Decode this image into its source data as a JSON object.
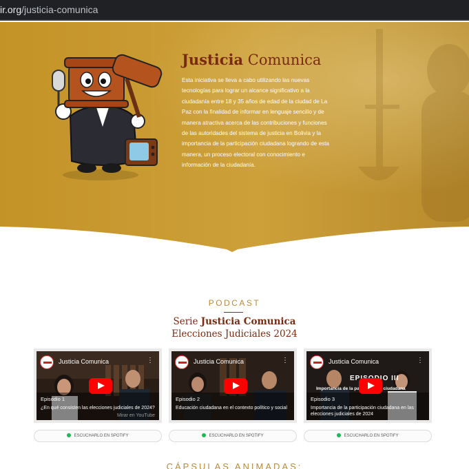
{
  "browser": {
    "url_domain": "ir.org",
    "url_path": "/justicia-comunica"
  },
  "hero": {
    "title_bold": "Justicia",
    "title_light": "Comunica",
    "description": "Esta iniciativa se lleva a cabo utilizando las nuevas tecnologías para lograr un alcance significativo a la ciudadanía entre 18 y 35 años de edad de la ciudad de La Paz con la finalidad de informar en lenguaje sencillo y de manera atractiva acerca de las contribuciones y funciones de las autoridades del sistema de justicia en Bolivia y la importancia de la participación ciudadana logrando de esta manera, un proceso electoral con conocimiento e información de la ciudadanía.",
    "colors": {
      "gold": "#c99a2e",
      "title": "#7a2a10"
    }
  },
  "podcast": {
    "label": "PODCAST",
    "series_prefix": "Serie",
    "series_name": "Justicia Comunica",
    "series_sub": "Elecciones Judiciales 2024",
    "episodes": [
      {
        "channel": "Justicia Comunica",
        "episode": "Episodio 1",
        "title": "¿En qué consisten las elecciones judiciales de 2024?",
        "watch": "Mirar en YouTube",
        "spotify": "ESCUCHARLO EN SPOTIFY"
      },
      {
        "channel": "Justicia Comunica",
        "episode": "Episodio 2",
        "title": "Educación ciudadana en el contexto político y social",
        "watch": "",
        "spotify": "ESCUCHARLO EN SPOTIFY"
      },
      {
        "channel": "Justicia Comunica",
        "episode": "Episodio 3",
        "title": "Importancia de la participación ciudadana en las elecciones judiciales de 2024",
        "overlay_big": "EPISODIO III",
        "overlay_small": "Importancia de la participación ciudadana",
        "watch": "",
        "spotify": "ESCUCHARLO EN SPOTIFY"
      }
    ]
  },
  "capsulas": {
    "label": "CÁPSULAS ANIMADAS:"
  }
}
